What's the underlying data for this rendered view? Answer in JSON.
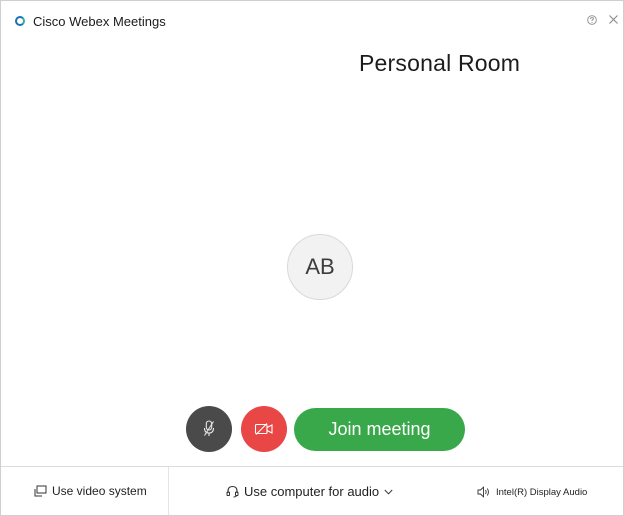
{
  "window": {
    "title": "Cisco Webex Meetings"
  },
  "main": {
    "room_title": "Personal Room",
    "avatar_initials": "AB"
  },
  "controls": {
    "mute_icon": "microphone-muted-icon",
    "video_icon": "video-off-icon",
    "join_label": "Join meeting"
  },
  "footer": {
    "video_system_label": "Use video system",
    "audio_label": "Use computer for audio",
    "speaker_label": "Intel(R) Display Audio"
  },
  "colors": {
    "join_green": "#39a84a",
    "video_off_red": "#e94646",
    "mute_gray": "#4a4a4a",
    "logo_blue": "#1a6fb5"
  }
}
